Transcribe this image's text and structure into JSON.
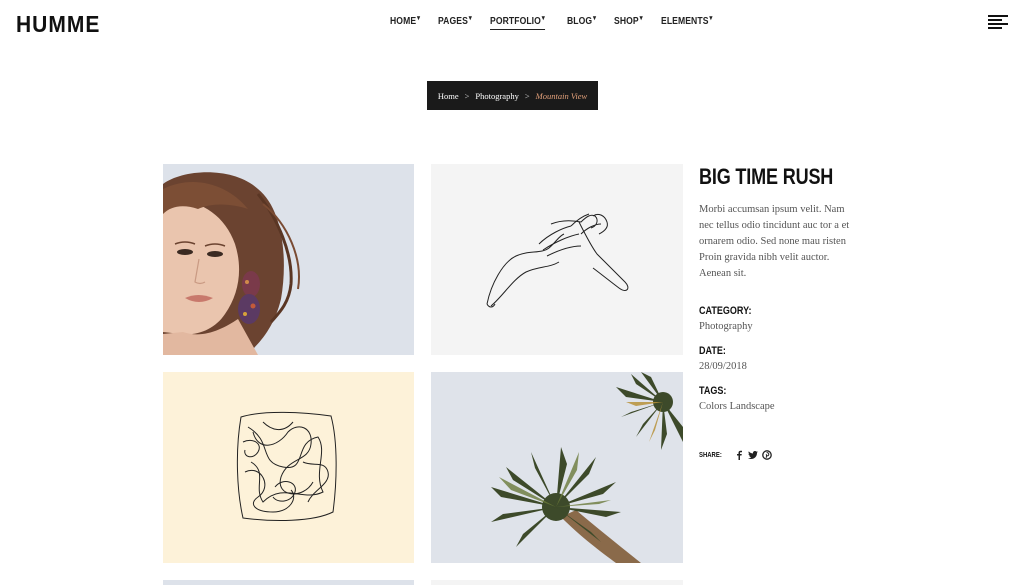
{
  "brand": {
    "logo": "HUMME"
  },
  "nav": {
    "items": [
      {
        "label": "HOME",
        "active": false
      },
      {
        "label": "PAGES",
        "active": false
      },
      {
        "label": "PORTFOLIO",
        "active": true
      },
      {
        "label": "BLOG",
        "active": false
      },
      {
        "label": "SHOP",
        "active": false
      },
      {
        "label": "ELEMENTS",
        "active": false
      }
    ],
    "menu_icon": "hamburger-menu-icon"
  },
  "breadcrumb": {
    "items": [
      "Home",
      "Photography"
    ],
    "separator": ">",
    "current": "Mountain View"
  },
  "gallery": {
    "tiles": [
      {
        "subject": "portrait-woman-earring",
        "background": "#dde2ea"
      },
      {
        "subject": "line-drawing-hands",
        "background": "#f4f4f4"
      },
      {
        "subject": "scribble-line-drawing",
        "background": "#fdf2d9"
      },
      {
        "subject": "palm-trees-sky",
        "background": "#dfe3ea"
      }
    ]
  },
  "project": {
    "title": "BIG TIME RUSH",
    "description": "Morbi accumsan ipsum velit. Nam nec tellus odio tincidunt auc tor a et ornarem odio. Sed none mau risten Proin gravida nibh velit auctor. Aenean sit.",
    "meta": [
      {
        "label": "CATEGORY:",
        "value": "Photography"
      },
      {
        "label": "DATE:",
        "value": "28/09/2018"
      },
      {
        "label": "TAGS:",
        "value": "Colors Landscape"
      }
    ],
    "share": {
      "label": "SHARE:",
      "icons": [
        "facebook-icon",
        "twitter-icon",
        "pinterest-icon"
      ]
    }
  },
  "colors": {
    "accent": "#e2a07a",
    "dark": "#1a1a1a"
  }
}
